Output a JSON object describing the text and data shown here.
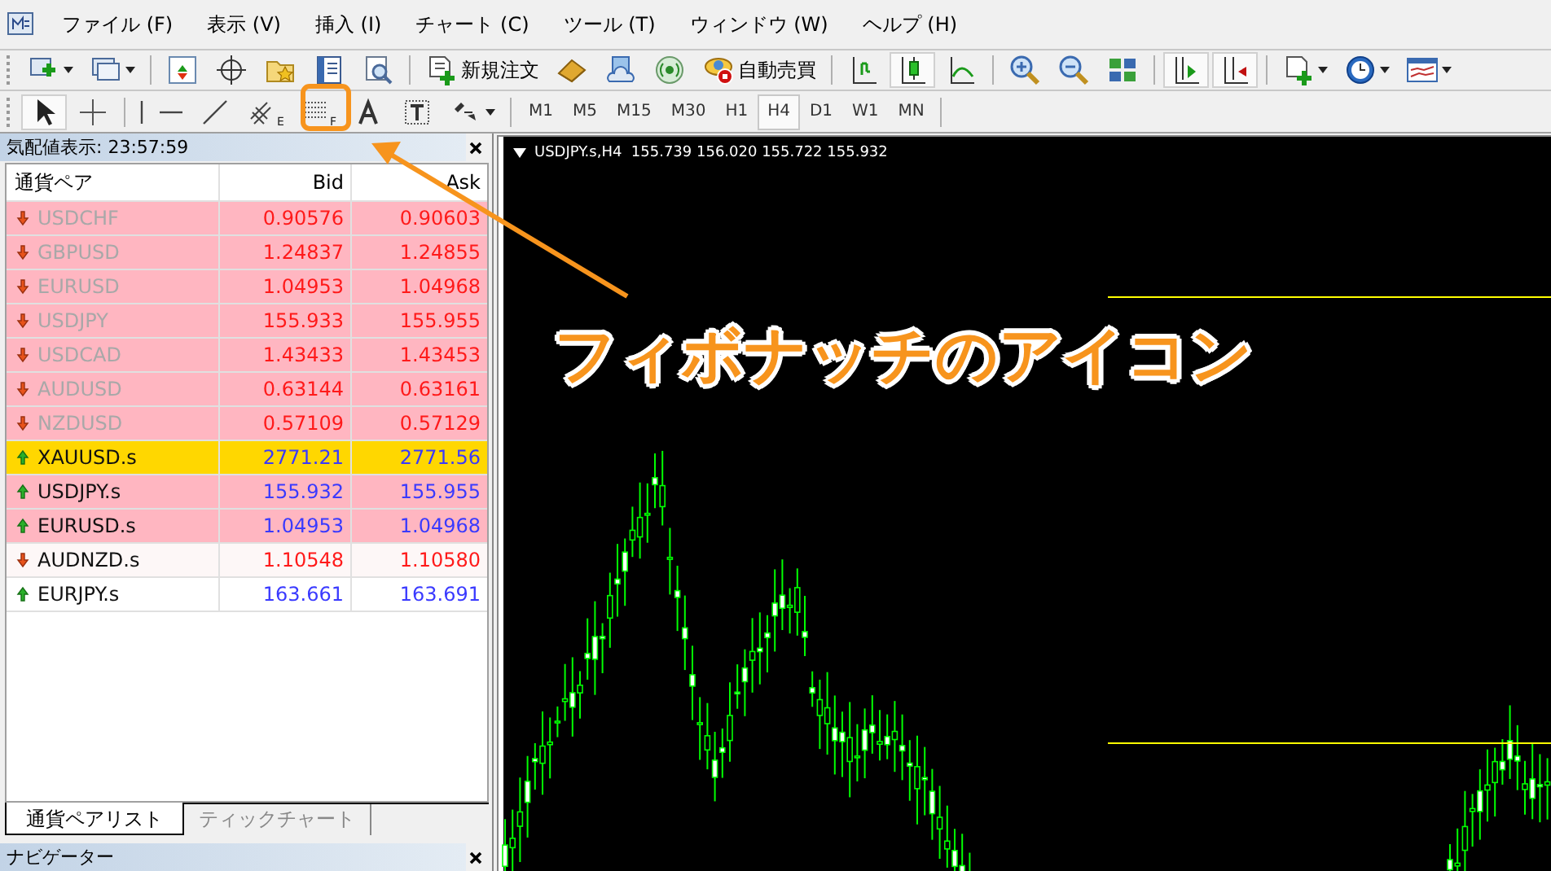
{
  "menu": [
    "ファイル (F)",
    "表示 (V)",
    "挿入 (I)",
    "チャート (C)",
    "ツール (T)",
    "ウィンドウ (W)",
    "ヘルプ (H)"
  ],
  "toolbar": {
    "new_order": "新規注文",
    "auto_trading": "自動売買",
    "channel_mark": "E",
    "fibonacci_mark": "F"
  },
  "timeframes": [
    {
      "label": "M1",
      "selected": false
    },
    {
      "label": "M5",
      "selected": false
    },
    {
      "label": "M15",
      "selected": false
    },
    {
      "label": "M30",
      "selected": false
    },
    {
      "label": "H1",
      "selected": false
    },
    {
      "label": "H4",
      "selected": true
    },
    {
      "label": "D1",
      "selected": false
    },
    {
      "label": "W1",
      "selected": false
    },
    {
      "label": "MN",
      "selected": false
    }
  ],
  "market_watch": {
    "title": "気配値表示: 23:57:59",
    "columns": [
      "通貨ペア",
      "Bid",
      "Ask"
    ],
    "rows": [
      {
        "symbol": "USDCHF",
        "bid": "0.90576",
        "ask": "0.90603",
        "up": false,
        "dimmed": true,
        "color": "#ffb6c1"
      },
      {
        "symbol": "GBPUSD",
        "bid": "1.24837",
        "ask": "1.24855",
        "up": false,
        "dimmed": true,
        "color": "#ffb6c1"
      },
      {
        "symbol": "EURUSD",
        "bid": "1.04953",
        "ask": "1.04968",
        "up": false,
        "dimmed": true,
        "color": "#ffb6c1"
      },
      {
        "symbol": "USDJPY",
        "bid": "155.933",
        "ask": "155.955",
        "up": false,
        "dimmed": true,
        "color": "#ffb6c1"
      },
      {
        "symbol": "USDCAD",
        "bid": "1.43433",
        "ask": "1.43453",
        "up": false,
        "dimmed": true,
        "color": "#ffb6c1"
      },
      {
        "symbol": "AUDUSD",
        "bid": "0.63144",
        "ask": "0.63161",
        "up": false,
        "dimmed": true,
        "color": "#ffb6c1"
      },
      {
        "symbol": "NZDUSD",
        "bid": "0.57109",
        "ask": "0.57129",
        "up": false,
        "dimmed": true,
        "color": "#ffb6c1"
      },
      {
        "symbol": "XAUUSD.s",
        "bid": "2771.21",
        "ask": "2771.56",
        "up": true,
        "dimmed": false,
        "color": "#ffd700"
      },
      {
        "symbol": "USDJPY.s",
        "bid": "155.932",
        "ask": "155.955",
        "up": true,
        "dimmed": false,
        "color": "#ffb6c1"
      },
      {
        "symbol": "EURUSD.s",
        "bid": "1.04953",
        "ask": "1.04968",
        "up": true,
        "dimmed": false,
        "color": "#ffb6c1"
      },
      {
        "symbol": "AUDNZD.s",
        "bid": "1.10548",
        "ask": "1.10580",
        "up": false,
        "dimmed": false,
        "color": "#fdf7f7"
      },
      {
        "symbol": "EURJPY.s",
        "bid": "163.661",
        "ask": "163.691",
        "up": true,
        "dimmed": false,
        "color": "#ffffff"
      }
    ],
    "tabs": [
      {
        "label": "通貨ペアリスト",
        "selected": true
      },
      {
        "label": "ティックチャート",
        "selected": false
      }
    ]
  },
  "navigator": {
    "title": "ナビゲーター"
  },
  "chart": {
    "header": "USDJPY.s,H4  155.739 156.020 155.722 155.932"
  },
  "annotation": {
    "text": "フィボナッチのアイコン"
  }
}
